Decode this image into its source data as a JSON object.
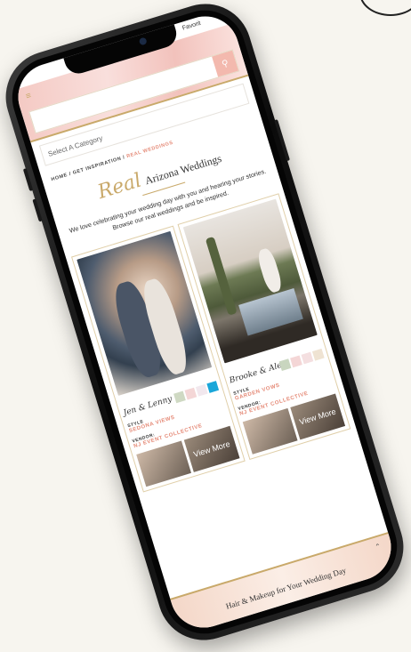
{
  "status": {
    "carrier": "Favorit"
  },
  "search": {
    "placeholder": "",
    "icon": "search-icon"
  },
  "category": {
    "placeholder": "Select A Category"
  },
  "breadcrumb": {
    "items": [
      "HOME",
      "GET INSPIRATION",
      "REAL WEDDINGS"
    ],
    "separator": "/"
  },
  "page": {
    "title_script": "Real",
    "title_rest": "Arizona Weddings",
    "intro": "We love celebrating your wedding day with you and hearing your stories. Browse our real weddings and be inspired."
  },
  "cards": [
    {
      "name": "Jen & Lenny",
      "style_label": "STYLE",
      "style_value": "SEDONA VIEWS",
      "vendor_label": "VENDOR:",
      "vendor_value": "NJ EVENT COLLECTIVE",
      "view_more": "View More",
      "swatches": [
        "#cfd9c3",
        "#f4d6d6",
        "#f2e8ee",
        "#1aa6d9"
      ]
    },
    {
      "name": "Brooke & Alex",
      "style_label": "STYLE",
      "style_value": "GARDEN VOWS",
      "vendor_label": "VENDOR:",
      "vendor_value": "NJ EVENT COLLECTIVE",
      "view_more": "View More",
      "swatches": [
        "#c9d6bf",
        "#f4d6d6",
        "#f4dfe0",
        "#efe3d2"
      ]
    }
  ],
  "banner": {
    "text": "Hair & Makeup for Your Wedding Day"
  },
  "colors": {
    "accent": "#c9a96a",
    "coral": "#e58a77",
    "hero_pink": "#f4c9c3"
  }
}
